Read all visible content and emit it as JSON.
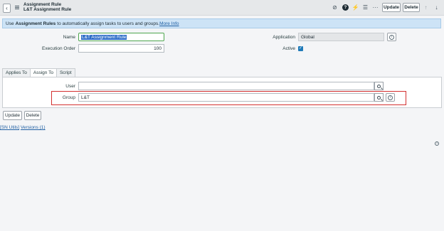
{
  "header": {
    "title": "Assignment Rule",
    "subtitle": "L&T Assignment Rule",
    "update_label": "Update",
    "delete_label": "Delete"
  },
  "info_banner": {
    "prefix": "Use",
    "bold": "Assignment Rules",
    "text": "to automatically assign tasks to users and groups.",
    "link": "More Info"
  },
  "form": {
    "name_label": "Name",
    "name_value": "L&T Assignment Rule",
    "execution_order_label": "Execution Order",
    "execution_order_value": "100",
    "application_label": "Application",
    "application_value": "Global",
    "active_label": "Active",
    "active_checked": true
  },
  "tabs": [
    {
      "label": "Applies To",
      "active": false
    },
    {
      "label": "Assign To",
      "active": true
    },
    {
      "label": "Script",
      "active": false
    }
  ],
  "assign_to": {
    "user_label": "User",
    "user_value": "",
    "group_label": "Group",
    "group_value": "L&T"
  },
  "buttons": {
    "update_label": "Update",
    "delete_label": "Delete"
  },
  "related_links": {
    "link1": "[SN Utils]",
    "link2": "Versions (1)"
  },
  "colors": {
    "banner_bg": "#cde3f6",
    "highlight": "#d32f2f",
    "selection": "#2f6ec8"
  }
}
